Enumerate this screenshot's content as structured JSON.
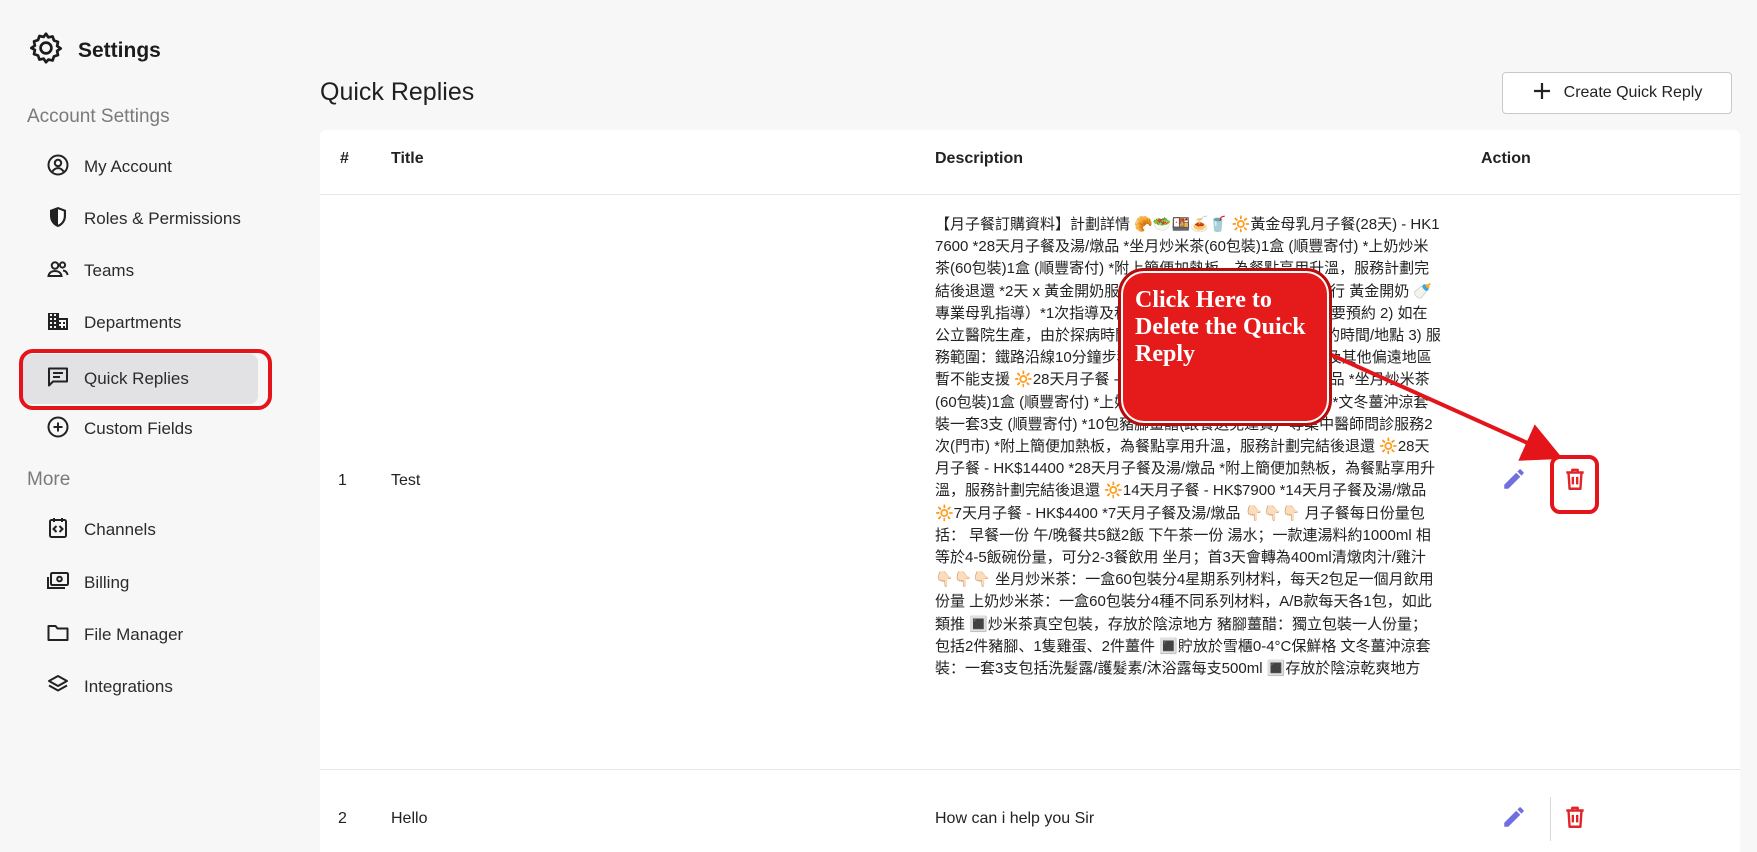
{
  "brand": {
    "title": "Settings"
  },
  "sidebar": {
    "section_account": "Account Settings",
    "section_more": "More",
    "items": [
      {
        "label": "My Account",
        "icon": "user-circle-icon"
      },
      {
        "label": "Roles & Permissions",
        "icon": "shield-icon"
      },
      {
        "label": "Teams",
        "icon": "people-icon"
      },
      {
        "label": "Departments",
        "icon": "building-icon"
      },
      {
        "label": "Quick Replies",
        "icon": "chat-icon",
        "active": true
      },
      {
        "label": "Custom Fields",
        "icon": "plus-circle-icon"
      },
      {
        "label": "Channels",
        "icon": "channels-icon"
      },
      {
        "label": "Billing",
        "icon": "billing-icon"
      },
      {
        "label": "File Manager",
        "icon": "folder-icon"
      },
      {
        "label": "Integrations",
        "icon": "layers-icon"
      }
    ]
  },
  "main": {
    "title": "Quick Replies",
    "create_label": "Create Quick Reply",
    "columns": {
      "num": "#",
      "title": "Title",
      "description": "Description",
      "action": "Action"
    },
    "rows": [
      {
        "num": "1",
        "title": "Test",
        "description": "【月子餐訂購資料】計劃詳情 🥐🥗🍱🍝🥤 🔆黃金母乳月子餐(28天) - HK17600 *28天月子餐及湯/燉品 *坐月炒米茶(60包裝)1盒 (順豐寄付) *上奶炒米茶(60包裝)1盒 (順豐寄付) *附上簡便加熱板，為餐點享用升溫，服務計劃完結後退還 *2天 x 黃金開奶服務（產後第1/2天到(私家)醫院進行 黃金開奶 🍼 專業母乳指導）*1次指導及科學通乳 註：1) 所有時間安排需要預約 2) 如在公立醫院生產，由於探病時間有限制，需雙方協商安排合適的時間/地點 3) 服務範圍：鐵路沿線10分鐘步程，屯門、元朗、西貢、愉景灣及其他偏遠地區暫不能支援 🔆28天月子餐 - HK$15900 *28天月子餐及湯/燉品 *坐月炒米茶(60包裝)1盒 (順豐寄付) *上奶炒米茶(60包裝)1盒 (順豐寄付) *文冬薑沖涼套裝一套3支 (順豐寄付) *10包豬腳薑醋(跟餐送免運費) *專業中醫師問診服務2次(門市) *附上簡便加熱板，為餐點享用升溫，服務計劃完結後退還 🔆28天月子餐 - HK$14400 *28天月子餐及湯/燉品 *附上簡便加熱板，為餐點享用升溫，服務計劃完結後退還 🔆14天月子餐 - HK$7900 *14天月子餐及湯/燉品 🔆7天月子餐 - HK$4400 *7天月子餐及湯/燉品 👇🏻👇🏻👇🏻 月子餐每日份量包括： 早餐一份 午/晚餐共5餸2飯 下午茶一份 湯水；一款連湯料約1000ml 相等於4-5飯碗份量，可分2-3餐飲用 坐月；首3天會轉為400ml清燉肉汁/雞汁 👇🏻👇🏻👇🏻 坐月炒米茶：一盒60包裝分4星期系列材料，每天2包足一個月飲用份量 上奶炒米茶：一盒60包裝分4種不同系列材料，A/B款每天各1包，如此類推 🔳炒米茶真空包裝，存放於陰涼地方 豬腳薑醋：獨立包裝一人份量； 包括2件豬腳、1隻雞蛋、2件薑件 🔳貯放於雪櫃0-4°C保鮮格 文冬薑沖涼套裝：一套3支包括洗髮露/護髮素/沐浴露每支500ml 🔳存放於陰涼乾爽地方"
      },
      {
        "num": "2",
        "title": "Hello",
        "description": "How can i help you Sir"
      }
    ]
  },
  "callout": {
    "text": "Click Here to Delete the Quick Reply"
  },
  "colors": {
    "accent": "#e4141b",
    "edit_icon": "#6f6fe0",
    "delete_icon": "#e0242a"
  }
}
